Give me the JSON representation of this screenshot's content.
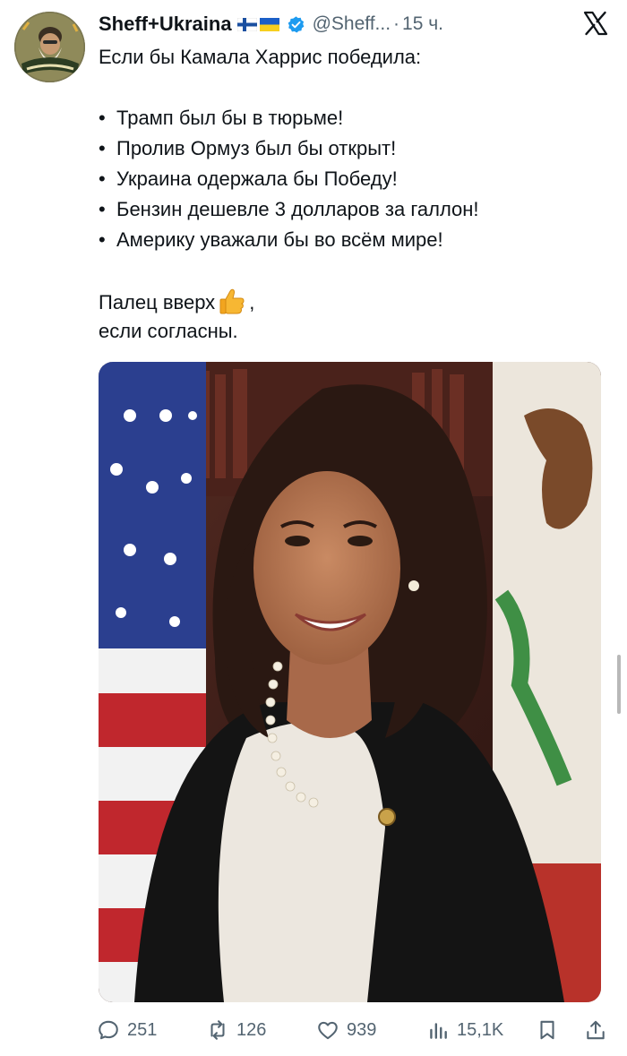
{
  "post": {
    "author_name": "Sheff+Ukraina",
    "handle": "@Sheff...",
    "separator": "·",
    "time": "15 ч.",
    "avatar_icon": "bearded-man-avatar",
    "flags": [
      "finland-flag-icon",
      "ukraine-flag-icon"
    ],
    "verified_icon": "verified-badge-icon",
    "lines": [
      "Если бы Камала Харрис победила:",
      "",
      "Трамп был бы в тюрьме!",
      "Пролив Ормуз был бы открыт!",
      "Украина одержала бы Победу!",
      "Бензин дешевле 3 долларов за галлон!",
      "Америку уважали бы во всём мире!",
      "",
      "Палец вверх",
      "если согласны."
    ],
    "bullet": "•",
    "thumbs_up_emoji": "👍",
    "after_emoji": ",",
    "image_alt_icon": "portrait-photo"
  },
  "actions": {
    "replies": "251",
    "reposts": "126",
    "likes": "939",
    "views": "15,1K"
  },
  "colors": {
    "text": "#0f1419",
    "muted": "#536471",
    "verified": "#1d9bf0",
    "background": "#ffffff"
  }
}
